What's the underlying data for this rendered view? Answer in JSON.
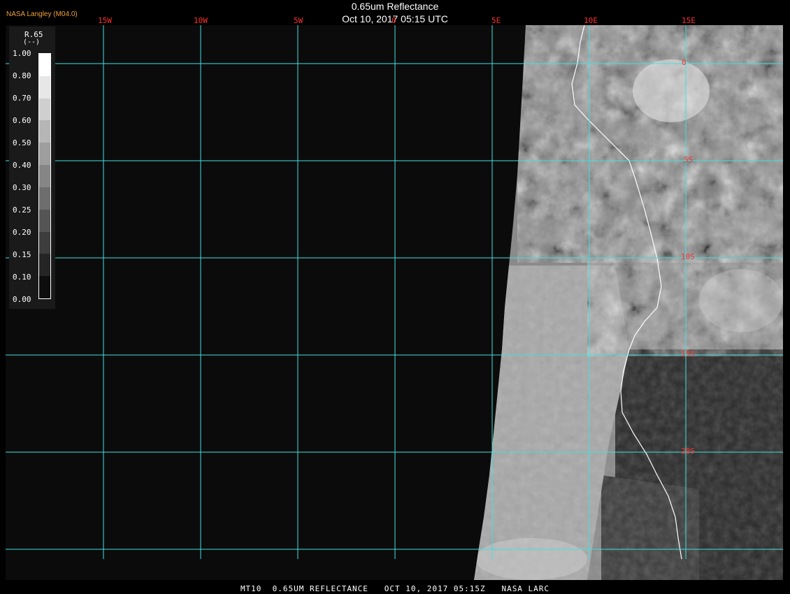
{
  "header": {
    "title": "0.65um Reflectance",
    "timestamp": "Oct 10, 2017 05:15 UTC",
    "organization": "NASA Langley (M04.0)"
  },
  "legend": {
    "variable": "R.65",
    "unit": "(--)",
    "ticks": [
      "1.00",
      "0.80",
      "0.70",
      "0.60",
      "0.50",
      "0.40",
      "0.30",
      "0.25",
      "0.20",
      "0.15",
      "0.10",
      "0.00"
    ]
  },
  "grid": {
    "longitudes": [
      "15W",
      "10W",
      "5W",
      "0",
      "5E",
      "10E",
      "15E"
    ],
    "latitudes": [
      "0",
      "5S",
      "10S",
      "15S",
      "20S"
    ]
  },
  "footer": "MT10  0.65UM REFLECTANCE   OCT 10, 2017 05:15Z   NASA LARC",
  "colors": {
    "grid": "#40e0e0",
    "labels": "#ff3030",
    "org": "#f0a030",
    "coast": "#ffffff"
  }
}
